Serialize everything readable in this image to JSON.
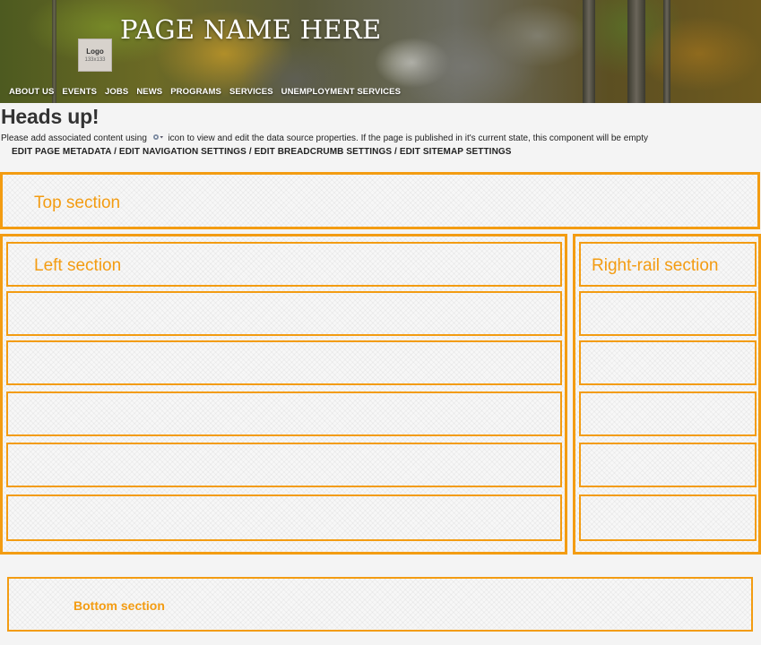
{
  "header": {
    "page_title": "PAGE NAME HERE",
    "logo": {
      "label": "Logo",
      "size_text": "133x133"
    },
    "nav": [
      "ABOUT US",
      "EVENTS",
      "JOBS",
      "NEWS",
      "PROGRAMS",
      "SERVICES",
      "UNEMPLOYMENT SERVICES"
    ]
  },
  "notice": {
    "title": "Heads up!",
    "text_before_icon": "Please add associated content using",
    "icon": "configure-icon",
    "text_after_icon": "icon to view and edit the data source properties. If the page is published in it's current state, this component will be empty"
  },
  "edit_links": {
    "page_metadata": "EDIT PAGE METADATA",
    "navigation_settings": "EDIT NAVIGATION SETTINGS",
    "breadcrumb_settings": "EDIT BREADCRUMB SETTINGS",
    "sitemap_settings": "EDIT SITEMAP SETTINGS",
    "separator": "/"
  },
  "sections": {
    "top": "Top section",
    "left": "Left section",
    "right_rail": "Right-rail section",
    "bottom": "Bottom section"
  },
  "colors": {
    "accent": "#f39c12",
    "text": "#222222"
  }
}
